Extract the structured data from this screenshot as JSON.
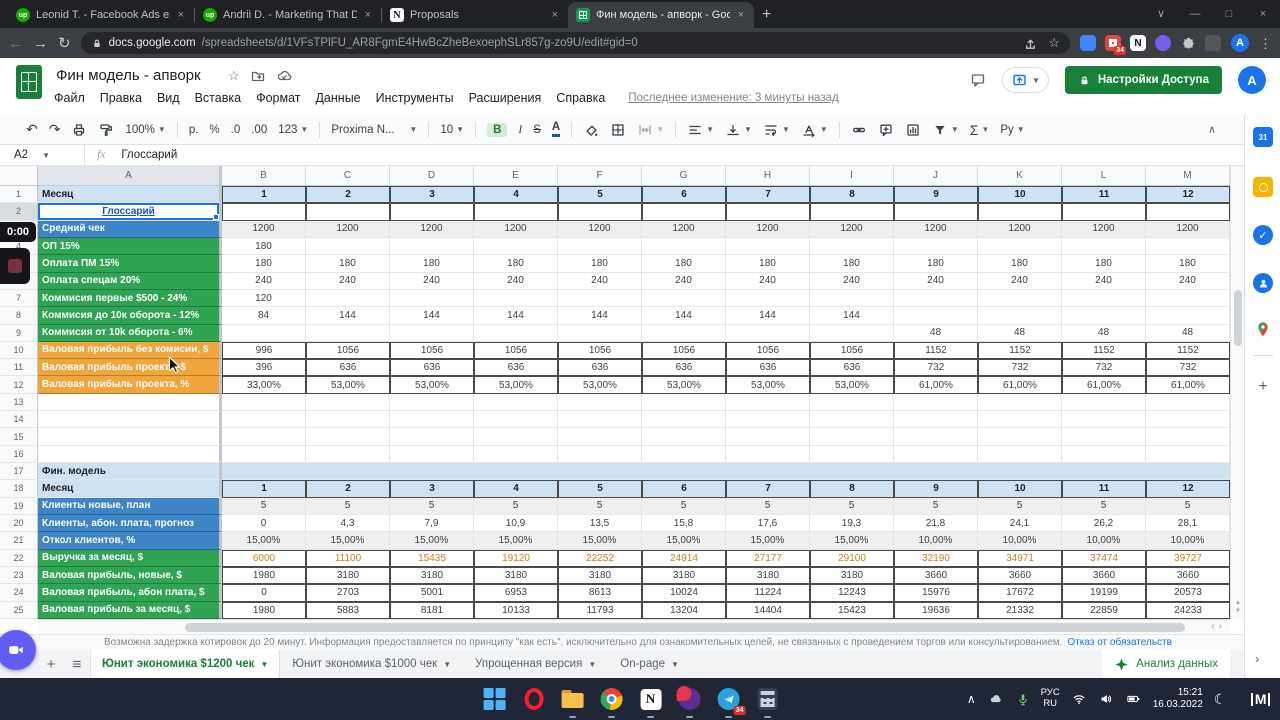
{
  "browser": {
    "tabs": [
      {
        "title": "Leonid T. - Facebook Ads expert",
        "favicon": "upwork-icon",
        "active": false
      },
      {
        "title": "Andrii D. - Marketing That Drive",
        "favicon": "upwork-icon",
        "active": false
      },
      {
        "title": "Proposals",
        "favicon": "notion-icon",
        "active": false
      },
      {
        "title": "Фин модель - апворк - Google",
        "favicon": "sheets-icon",
        "active": true
      }
    ],
    "new_tab_label": "+",
    "window_controls": [
      "∨",
      "—",
      "□",
      "×"
    ],
    "url_host": "docs.google.com",
    "url_path": "/spreadsheets/d/1VFsTPlFU_AR8FgmE4HwBcZheBexoephSLr857g-zo9U/edit#gid=0",
    "extensions": [
      {
        "name": "extension-blue-icon",
        "color": "#4285f4"
      },
      {
        "name": "extension-red-grid-icon",
        "color": "#e8453c",
        "badge": "34"
      },
      {
        "name": "notion-extension-icon",
        "color": "#ffffff"
      },
      {
        "name": "extension-purple-icon",
        "color": "#7b5cf0"
      },
      {
        "name": "extensions-puzzle-icon",
        "color": ""
      },
      {
        "name": "extension-dark-icon",
        "color": "#53565c"
      }
    ],
    "avatar_letter": "A"
  },
  "header": {
    "title": "Фин модель - апворк",
    "menus": [
      "Файл",
      "Правка",
      "Вид",
      "Вставка",
      "Формат",
      "Данные",
      "Инструменты",
      "Расширения",
      "Справка"
    ],
    "last_edit": "Последнее изменение: 3 минуты назад",
    "share_button": "Настройки Доступа",
    "avatar_letter": "A"
  },
  "toolbar": {
    "items": [
      {
        "type": "glyph",
        "glyph": "↶",
        "name": "undo-icon"
      },
      {
        "type": "glyph",
        "glyph": "↷",
        "name": "redo-icon"
      },
      {
        "type": "svg",
        "name": "print-icon"
      },
      {
        "type": "svg",
        "name": "paint-format-icon"
      },
      {
        "type": "text",
        "label": "100%",
        "caret": true,
        "name": "zoom-select"
      },
      {
        "type": "div"
      },
      {
        "type": "text",
        "label": "p.",
        "name": "currency-format-button"
      },
      {
        "type": "text",
        "label": "%",
        "name": "percent-format-button"
      },
      {
        "type": "text",
        "label": ".0",
        "name": "decrease-decimal-button"
      },
      {
        "type": "text",
        "label": ".00",
        "name": "increase-decimal-button"
      },
      {
        "type": "text",
        "label": "123",
        "caret": true,
        "name": "number-format-select"
      },
      {
        "type": "div"
      },
      {
        "type": "text",
        "label": "Proxima N...",
        "caret": true,
        "name": "font-family-select",
        "cls": "wide"
      },
      {
        "type": "div"
      },
      {
        "type": "text",
        "label": "10",
        "caret": true,
        "name": "font-size-select"
      },
      {
        "type": "div"
      },
      {
        "type": "text",
        "label": "B",
        "name": "bold-button",
        "cls": "b"
      },
      {
        "type": "text",
        "label": "I",
        "name": "italic-button",
        "cls": "i"
      },
      {
        "type": "text",
        "label": "S",
        "name": "strikethrough-button",
        "cls": "s"
      },
      {
        "type": "text",
        "label": "A",
        "name": "text-color-button",
        "cls": "a"
      },
      {
        "type": "div"
      },
      {
        "type": "svg",
        "name": "fill-color-icon"
      },
      {
        "type": "svg",
        "name": "borders-icon"
      },
      {
        "type": "svg",
        "name": "merge-cells-icon",
        "caret": true,
        "cls": "dim"
      },
      {
        "type": "div"
      },
      {
        "type": "svg",
        "name": "align-left-icon",
        "caret": true
      },
      {
        "type": "svg",
        "name": "vertical-align-icon",
        "caret": true
      },
      {
        "type": "svg",
        "name": "text-wrap-icon",
        "caret": true
      },
      {
        "type": "svg",
        "name": "text-rotate-icon",
        "caret": true
      },
      {
        "type": "div"
      },
      {
        "type": "svg",
        "name": "insert-link-icon"
      },
      {
        "type": "svg",
        "name": "insert-comment-icon"
      },
      {
        "type": "svg",
        "name": "insert-chart-icon"
      },
      {
        "type": "svg",
        "name": "filter-icon",
        "caret": true
      },
      {
        "type": "glyph",
        "glyph": "Σ",
        "name": "functions-icon",
        "caret": true
      },
      {
        "type": "text",
        "label": "Ру",
        "caret": true,
        "name": "input-tools-select"
      }
    ],
    "collapse_glyph": "∧"
  },
  "formula_bar": {
    "cell_ref": "A2",
    "fx": "fx",
    "value": "Глоссарий"
  },
  "grid": {
    "columns": [
      "A",
      "B",
      "C",
      "D",
      "E",
      "F",
      "G",
      "H",
      "I",
      "J",
      "K",
      "L",
      "M"
    ],
    "rows": [
      {
        "n": 1,
        "label": "Месяц",
        "style": "monthhead",
        "bordered": true,
        "cells": [
          "1",
          "2",
          "3",
          "4",
          "5",
          "6",
          "7",
          "8",
          "9",
          "10",
          "11",
          "12"
        ]
      },
      {
        "n": 2,
        "label": "Глоссарий",
        "style": "link",
        "bordered": true,
        "cells": [
          "",
          "",
          "",
          "",
          "",
          "",
          "",
          "",
          "",
          "",
          "",
          ""
        ]
      },
      {
        "n": 3,
        "label": "Средний чек",
        "style": "blue",
        "gray": true,
        "cells": [
          "1200",
          "1200",
          "1200",
          "1200",
          "1200",
          "1200",
          "1200",
          "1200",
          "1200",
          "1200",
          "1200",
          "1200"
        ]
      },
      {
        "n": 4,
        "label": "ОП 15%",
        "style": "green",
        "cells": [
          "180",
          "",
          "",
          "",
          "",
          "",
          "",
          "",
          "",
          "",
          "",
          ""
        ]
      },
      {
        "n": 5,
        "label": "Оплата ПМ 15%",
        "style": "green",
        "cells": [
          "180",
          "180",
          "180",
          "180",
          "180",
          "180",
          "180",
          "180",
          "180",
          "180",
          "180",
          "180"
        ]
      },
      {
        "n": 6,
        "label": "Оплата спецам 20%",
        "style": "green",
        "cells": [
          "240",
          "240",
          "240",
          "240",
          "240",
          "240",
          "240",
          "240",
          "240",
          "240",
          "240",
          "240"
        ]
      },
      {
        "n": 7,
        "label": "Коммисия первые $500 - 24%",
        "style": "green",
        "cells": [
          "120",
          "",
          "",
          "",
          "",
          "",
          "",
          "",
          "",
          "",
          "",
          ""
        ]
      },
      {
        "n": 8,
        "label": "Коммисия до 10к оборота - 12%",
        "style": "green",
        "cells": [
          "84",
          "144",
          "144",
          "144",
          "144",
          "144",
          "144",
          "144",
          "",
          "",
          "",
          ""
        ]
      },
      {
        "n": 9,
        "label": "Коммисия от 10k оборота - 6%",
        "style": "green",
        "cells": [
          "",
          "",
          "",
          "",
          "",
          "",
          "",
          "",
          "48",
          "48",
          "48",
          "48"
        ]
      },
      {
        "n": 10,
        "label": "Валовая прибыль без комисии, $",
        "style": "yellow",
        "bordered": true,
        "cells": [
          "996",
          "1056",
          "1056",
          "1056",
          "1056",
          "1056",
          "1056",
          "1056",
          "1152",
          "1152",
          "1152",
          "1152"
        ]
      },
      {
        "n": 11,
        "label": "Валовая прибыль проекта, $",
        "style": "yellow",
        "bordered": true,
        "cells": [
          "396",
          "636",
          "636",
          "636",
          "636",
          "636",
          "636",
          "636",
          "732",
          "732",
          "732",
          "732"
        ]
      },
      {
        "n": 12,
        "label": "Валовая прибыль проекта, %",
        "style": "yellow",
        "bordered": true,
        "cells": [
          "33,00%",
          "53,00%",
          "53,00%",
          "53,00%",
          "53,00%",
          "53,00%",
          "53,00%",
          "53,00%",
          "61,00%",
          "61,00%",
          "61,00%",
          "61,00%"
        ]
      },
      {
        "n": 13,
        "label": "",
        "style": "plain",
        "cells": [
          "",
          "",
          "",
          "",
          "",
          "",
          "",
          "",
          "",
          "",
          "",
          ""
        ]
      },
      {
        "n": 14,
        "label": "",
        "style": "plain",
        "cells": [
          "",
          "",
          "",
          "",
          "",
          "",
          "",
          "",
          "",
          "",
          "",
          ""
        ]
      },
      {
        "n": 15,
        "label": "",
        "style": "plain",
        "cells": [
          "",
          "",
          "",
          "",
          "",
          "",
          "",
          "",
          "",
          "",
          "",
          ""
        ]
      },
      {
        "n": 16,
        "label": "",
        "style": "plain",
        "cells": [
          "",
          "",
          "",
          "",
          "",
          "",
          "",
          "",
          "",
          "",
          "",
          ""
        ]
      },
      {
        "n": 17,
        "label": "Фин. модель",
        "style": "section",
        "cells": []
      },
      {
        "n": 18,
        "label": "Месяц",
        "style": "monthhead",
        "bordered": true,
        "cells": [
          "1",
          "2",
          "3",
          "4",
          "5",
          "6",
          "7",
          "8",
          "9",
          "10",
          "11",
          "12"
        ]
      },
      {
        "n": 19,
        "label": "Клиенты новые, план",
        "style": "blue",
        "gray": true,
        "cells": [
          "5",
          "5",
          "5",
          "5",
          "5",
          "5",
          "5",
          "5",
          "5",
          "5",
          "5",
          "5"
        ]
      },
      {
        "n": 20,
        "label": "Клиенты, абон. плата, прогноз",
        "style": "blue",
        "cells": [
          "0",
          "4,3",
          "7,9",
          "10,9",
          "13,5",
          "15,8",
          "17,6",
          "19,3",
          "21,8",
          "24,1",
          "26,2",
          "28,1"
        ]
      },
      {
        "n": 21,
        "label": "Откол клиентов, %",
        "style": "blue",
        "gray": true,
        "cells": [
          "15,00%",
          "15,00%",
          "15,00%",
          "15,00%",
          "15,00%",
          "15,00%",
          "15,00%",
          "15,00%",
          "10,00%",
          "10,00%",
          "10,00%",
          "10,00%"
        ]
      },
      {
        "n": 22,
        "label": "Выручка за месяц, $",
        "style": "green",
        "bordered": true,
        "vc": true,
        "cells": [
          "6000",
          "11100",
          "15435",
          "19120",
          "22252",
          "24914",
          "27177",
          "29100",
          "32190",
          "34971",
          "37474",
          "39727"
        ]
      },
      {
        "n": 23,
        "label": "Валовая прибыль, новые, $",
        "style": "green",
        "bordered": true,
        "cells": [
          "1980",
          "3180",
          "3180",
          "3180",
          "3180",
          "3180",
          "3180",
          "3180",
          "3660",
          "3660",
          "3660",
          "3660"
        ]
      },
      {
        "n": 24,
        "label": "Валовая прибыль, абон плата, $",
        "style": "green",
        "bordered": true,
        "cells": [
          "0",
          "2703",
          "5001",
          "6953",
          "8613",
          "10024",
          "11224",
          "12243",
          "15976",
          "17672",
          "19199",
          "20573"
        ]
      },
      {
        "n": 25,
        "label": "Валовая прибыль за месяц, $",
        "style": "green",
        "bordered": true,
        "cells": [
          "1980",
          "5883",
          "8181",
          "10133",
          "11793",
          "13204",
          "14404",
          "15423",
          "19636",
          "21332",
          "22859",
          "24233"
        ]
      }
    ],
    "colors": {
      "blue_label": "#3d85c6",
      "green_label": "#2fa452",
      "yellow_label": "#f0a63c",
      "light_blue_header": "#cfe2f3",
      "gray_fill": "#efefef"
    }
  },
  "recording": {
    "timer": "0:00"
  },
  "sidepanel": {
    "items": [
      "calendar-icon",
      "keep-icon",
      "tasks-icon",
      "contacts-icon",
      "maps-icon"
    ],
    "calendar_label": "31",
    "plus_label": "+",
    "chevron": "›"
  },
  "footer": {
    "disclaimer": "Возможна задержка котировок до 20 минут. Информация предоставляется по принципу \"как есть\", исключительно для ознакомительных целей, не связанных с проведением торгов или консультированием.",
    "disclaimer_link": "Отказ от обязательств",
    "add_sheet_label": "+",
    "all_sheets_glyph": "≡",
    "sheet_tabs": [
      {
        "label": "Юнит экономика $1200 чек",
        "active": true
      },
      {
        "label": "Юнит экономика $1000 чек",
        "active": false
      },
      {
        "label": "Упрощенная версия",
        "active": false
      },
      {
        "label": "On-page",
        "active": false
      }
    ],
    "explore_label": "Анализ данных"
  },
  "taskbar": {
    "apps": [
      {
        "name": "start-button",
        "kind": "start"
      },
      {
        "name": "opera-icon",
        "kind": "opera",
        "running": false
      },
      {
        "name": "file-explorer-icon",
        "kind": "folder",
        "running": true
      },
      {
        "name": "chrome-icon",
        "kind": "chrome",
        "running": true
      },
      {
        "name": "notion-icon",
        "kind": "notion",
        "running": true
      },
      {
        "name": "gitkraken-icon",
        "kind": "kraken",
        "running": true
      },
      {
        "name": "telegram-icon",
        "kind": "telegram",
        "running": true,
        "badge": "34"
      },
      {
        "name": "calculator-icon",
        "kind": "calc",
        "running": true
      }
    ],
    "tray": {
      "chevron": "∧",
      "lang_line1": "РУС",
      "lang_line2": "RU",
      "time": "15:21",
      "date": "16.03.2022",
      "moon": "☾"
    }
  }
}
